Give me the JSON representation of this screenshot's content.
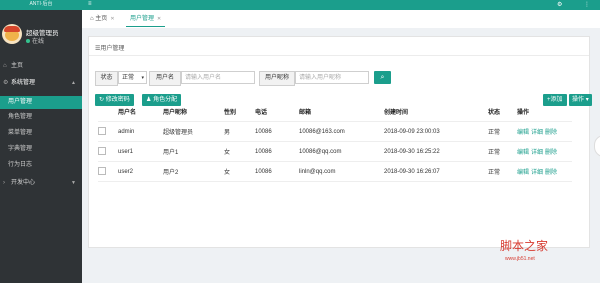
{
  "sidebar": {
    "top_label": "ANTI·后台",
    "user_name": "超级管理员",
    "user_status": "在线",
    "items": [
      {
        "label": "主页",
        "icon": "home-icon"
      },
      {
        "label": "系统管理",
        "icon": "gear-icon"
      },
      {
        "label": "开发中心",
        "icon": "code-icon"
      }
    ],
    "sub_items": [
      "用户管理",
      "角色管理",
      "菜单管理",
      "字典管理",
      "行为日志"
    ]
  },
  "topbar": {
    "icons": [
      "settings-icon",
      "menu-icon"
    ]
  },
  "tabs": [
    {
      "label": "主页",
      "icon": "home-icon"
    },
    {
      "label": "用户管理"
    }
  ],
  "panel": {
    "title": "用户管理"
  },
  "filters": {
    "status_label": "状态",
    "status_value": "正常",
    "username_label": "用户名",
    "username_placeholder": "请输入用户名",
    "nickname_label": "用户昵称",
    "nickname_placeholder": "请输入用户昵称"
  },
  "toolbar": {
    "change_password": "修改密码",
    "assign_role": "角色分配",
    "add": "添加",
    "actions": "操作"
  },
  "table": {
    "headers": [
      "用户名",
      "用户昵称",
      "性别",
      "电话",
      "邮箱",
      "创建时间",
      "状态",
      "操作"
    ],
    "rows": [
      {
        "username": "admin",
        "nickname": "超级管理员",
        "gender": "男",
        "phone": "10086",
        "email": "10086@163.com",
        "created": "2018-09-09 23:00:03",
        "status": "正常"
      },
      {
        "username": "user1",
        "nickname": "用户1",
        "gender": "女",
        "phone": "10086",
        "email": "10086@qq.com",
        "created": "2018-09-30 16:25:22",
        "status": "正常"
      },
      {
        "username": "user2",
        "nickname": "用户2",
        "gender": "女",
        "phone": "10086",
        "email": "linln@qq.com",
        "created": "2018-09-30 16:26:07",
        "status": "正常"
      }
    ],
    "row_actions": [
      "编辑",
      "详细",
      "删除"
    ]
  },
  "watermark": {
    "title": "脚本之家",
    "url": "www.jb51.net"
  },
  "colors": {
    "accent": "#1b9e8c",
    "sidebar": "#2f3336"
  }
}
